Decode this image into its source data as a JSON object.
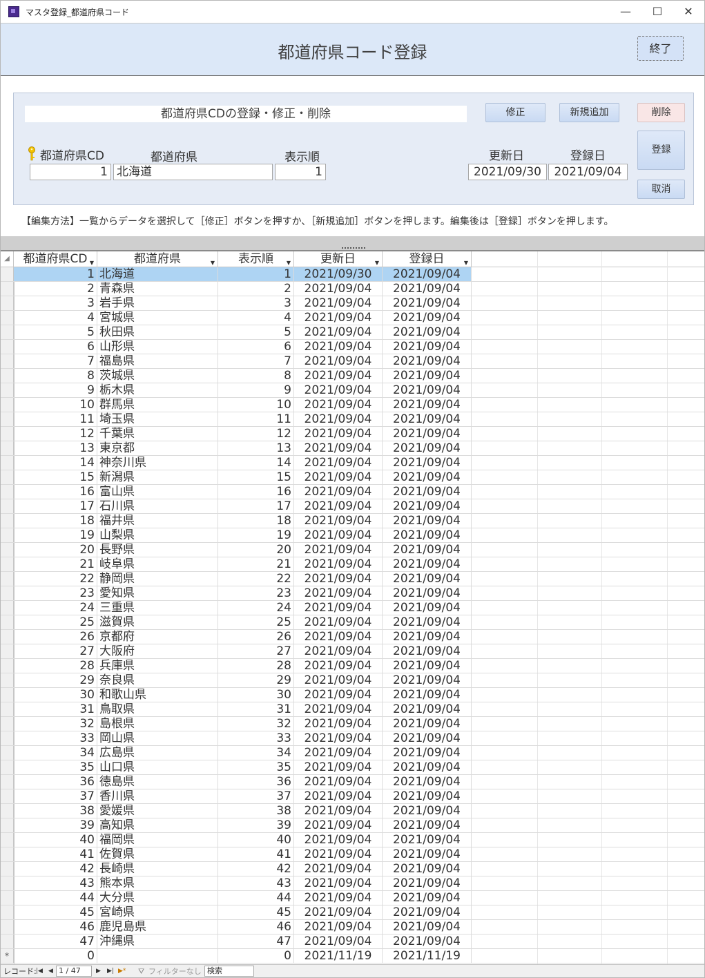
{
  "window": {
    "title": "マスタ登録_都道府県コード",
    "minimize_glyph": "—",
    "maximize_glyph": "☐",
    "close_glyph": "✕"
  },
  "header": {
    "title": "都道府県コード登録",
    "end_label": "終了"
  },
  "panel": {
    "caption": "都道府県CDの登録・修正・削除",
    "buttons": {
      "modify": "修正",
      "add": "新規追加",
      "delete": "削除",
      "register": "登録",
      "cancel": "取消"
    },
    "labels": {
      "code": "都道府県CD",
      "pref": "都道府県",
      "order": "表示順",
      "updated": "更新日",
      "registered": "登録日"
    },
    "values": {
      "code": "1",
      "pref": "北海道",
      "order": "1",
      "updated": "2021/09/30",
      "registered": "2021/09/04"
    }
  },
  "instructions": "【編集方法】一覧からデータを選択して［修正］ボタンを押すか、［新規追加］ボタンを押します。編集後は［登録］ボタンを押します。",
  "grid": {
    "columns": [
      "都道府県CD",
      "都道府県",
      "表示順",
      "更新日",
      "登録日"
    ],
    "rows": [
      [
        "1",
        "北海道",
        "1",
        "2021/09/30",
        "2021/09/04"
      ],
      [
        "2",
        "青森県",
        "2",
        "2021/09/04",
        "2021/09/04"
      ],
      [
        "3",
        "岩手県",
        "3",
        "2021/09/04",
        "2021/09/04"
      ],
      [
        "4",
        "宮城県",
        "4",
        "2021/09/04",
        "2021/09/04"
      ],
      [
        "5",
        "秋田県",
        "5",
        "2021/09/04",
        "2021/09/04"
      ],
      [
        "6",
        "山形県",
        "6",
        "2021/09/04",
        "2021/09/04"
      ],
      [
        "7",
        "福島県",
        "7",
        "2021/09/04",
        "2021/09/04"
      ],
      [
        "8",
        "茨城県",
        "8",
        "2021/09/04",
        "2021/09/04"
      ],
      [
        "9",
        "栃木県",
        "9",
        "2021/09/04",
        "2021/09/04"
      ],
      [
        "10",
        "群馬県",
        "10",
        "2021/09/04",
        "2021/09/04"
      ],
      [
        "11",
        "埼玉県",
        "11",
        "2021/09/04",
        "2021/09/04"
      ],
      [
        "12",
        "千葉県",
        "12",
        "2021/09/04",
        "2021/09/04"
      ],
      [
        "13",
        "東京都",
        "13",
        "2021/09/04",
        "2021/09/04"
      ],
      [
        "14",
        "神奈川県",
        "14",
        "2021/09/04",
        "2021/09/04"
      ],
      [
        "15",
        "新潟県",
        "15",
        "2021/09/04",
        "2021/09/04"
      ],
      [
        "16",
        "富山県",
        "16",
        "2021/09/04",
        "2021/09/04"
      ],
      [
        "17",
        "石川県",
        "17",
        "2021/09/04",
        "2021/09/04"
      ],
      [
        "18",
        "福井県",
        "18",
        "2021/09/04",
        "2021/09/04"
      ],
      [
        "19",
        "山梨県",
        "19",
        "2021/09/04",
        "2021/09/04"
      ],
      [
        "20",
        "長野県",
        "20",
        "2021/09/04",
        "2021/09/04"
      ],
      [
        "21",
        "岐阜県",
        "21",
        "2021/09/04",
        "2021/09/04"
      ],
      [
        "22",
        "静岡県",
        "22",
        "2021/09/04",
        "2021/09/04"
      ],
      [
        "23",
        "愛知県",
        "23",
        "2021/09/04",
        "2021/09/04"
      ],
      [
        "24",
        "三重県",
        "24",
        "2021/09/04",
        "2021/09/04"
      ],
      [
        "25",
        "滋賀県",
        "25",
        "2021/09/04",
        "2021/09/04"
      ],
      [
        "26",
        "京都府",
        "26",
        "2021/09/04",
        "2021/09/04"
      ],
      [
        "27",
        "大阪府",
        "27",
        "2021/09/04",
        "2021/09/04"
      ],
      [
        "28",
        "兵庫県",
        "28",
        "2021/09/04",
        "2021/09/04"
      ],
      [
        "29",
        "奈良県",
        "29",
        "2021/09/04",
        "2021/09/04"
      ],
      [
        "30",
        "和歌山県",
        "30",
        "2021/09/04",
        "2021/09/04"
      ],
      [
        "31",
        "鳥取県",
        "31",
        "2021/09/04",
        "2021/09/04"
      ],
      [
        "32",
        "島根県",
        "32",
        "2021/09/04",
        "2021/09/04"
      ],
      [
        "33",
        "岡山県",
        "33",
        "2021/09/04",
        "2021/09/04"
      ],
      [
        "34",
        "広島県",
        "34",
        "2021/09/04",
        "2021/09/04"
      ],
      [
        "35",
        "山口県",
        "35",
        "2021/09/04",
        "2021/09/04"
      ],
      [
        "36",
        "徳島県",
        "36",
        "2021/09/04",
        "2021/09/04"
      ],
      [
        "37",
        "香川県",
        "37",
        "2021/09/04",
        "2021/09/04"
      ],
      [
        "38",
        "愛媛県",
        "38",
        "2021/09/04",
        "2021/09/04"
      ],
      [
        "39",
        "高知県",
        "39",
        "2021/09/04",
        "2021/09/04"
      ],
      [
        "40",
        "福岡県",
        "40",
        "2021/09/04",
        "2021/09/04"
      ],
      [
        "41",
        "佐賀県",
        "41",
        "2021/09/04",
        "2021/09/04"
      ],
      [
        "42",
        "長崎県",
        "42",
        "2021/09/04",
        "2021/09/04"
      ],
      [
        "43",
        "熊本県",
        "43",
        "2021/09/04",
        "2021/09/04"
      ],
      [
        "44",
        "大分県",
        "44",
        "2021/09/04",
        "2021/09/04"
      ],
      [
        "45",
        "宮崎県",
        "45",
        "2021/09/04",
        "2021/09/04"
      ],
      [
        "46",
        "鹿児島県",
        "46",
        "2021/09/04",
        "2021/09/04"
      ],
      [
        "47",
        "沖縄県",
        "47",
        "2021/09/04",
        "2021/09/04"
      ],
      [
        "0",
        "",
        "0",
        "2021/11/19",
        "2021/11/19"
      ]
    ],
    "selected_row": 0,
    "new_row_marker": "*",
    "row_selector_corner": "◢"
  },
  "navbar": {
    "record_label": "レコード:",
    "first_glyph": "|◀",
    "prev_glyph": "◀",
    "position": "1 / 47",
    "next_glyph": "▶",
    "last_glyph": "▶|",
    "new_glyph": "▶*",
    "filter_label": "フィルターなし",
    "search_placeholder": "検索"
  },
  "colors": {
    "header_bg": "#dce8f8",
    "panel_bg": "#e6ecf6",
    "selected_row": "#aed4f3",
    "delete_button": "#f9e6e6"
  }
}
